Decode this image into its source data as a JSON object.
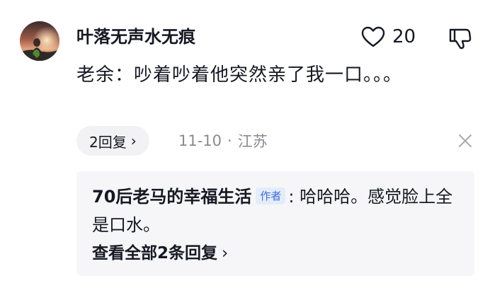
{
  "comment": {
    "username": "叶落无声水无痕",
    "like_count": "20",
    "text": "老余：吵着吵着他突然亲了我一口。。。",
    "reply_button_label": "2回复",
    "reply_chevron": "›",
    "date": "11-10",
    "separator": "·",
    "location": "江苏"
  },
  "reply": {
    "author": "70后老马的幸福生活",
    "badge": "作者",
    "text": ": 哈哈哈。感觉脸上全是口水。",
    "view_all_label": "查看全部2条回复",
    "view_all_chevron": "›"
  },
  "icons": {
    "like": "heart-outline-icon",
    "dislike": "thumbs-down-outline-icon",
    "close": "close-icon"
  },
  "colors": {
    "text_primary": "#161823",
    "text_secondary": "#8a8b91",
    "chip_background": "#f2f2f4",
    "reply_background": "#f6f6f8",
    "badge_text": "#3b6fd8",
    "badge_background": "#e4ecfb"
  }
}
